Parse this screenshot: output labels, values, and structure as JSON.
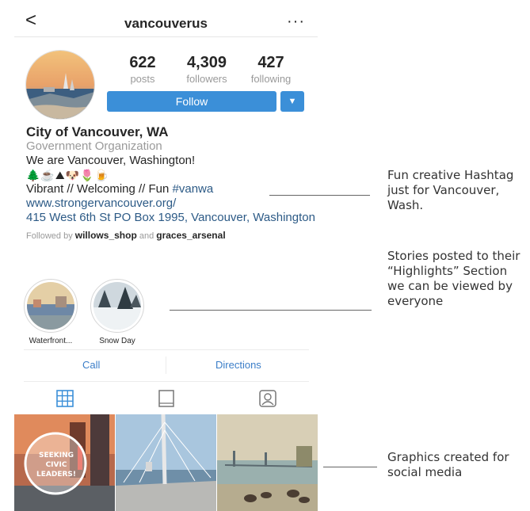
{
  "header": {
    "username": "vancouverus",
    "back_glyph": "<",
    "more_glyph": "···"
  },
  "stats": {
    "posts": {
      "value": "622",
      "label": "posts"
    },
    "followers": {
      "value": "4,309",
      "label": "followers"
    },
    "following": {
      "value": "427",
      "label": "following"
    }
  },
  "follow_button": {
    "label": "Follow",
    "dropdown_glyph": "▼"
  },
  "bio": {
    "name": "City of Vancouver, WA",
    "category": "Government Organization",
    "line1": "We are Vancouver, Washington!",
    "emoji": "🌲☕⛰🐶🌷🍺",
    "line3_text": "Vibrant // Welcoming // Fun ",
    "line3_hashtag": "#vanwa",
    "website": "www.strongervancouver.org/",
    "address": "415 West 6th St PO Box 1995, Vancouver, Washington",
    "followed_prefix": "Followed by ",
    "followed_user1": "willows_shop",
    "followed_and": " and ",
    "followed_user2": "graces_arsenal"
  },
  "highlights": [
    {
      "label": "Waterfront..."
    },
    {
      "label": "Snow Day"
    }
  ],
  "actions": {
    "call": "Call",
    "directions": "Directions"
  },
  "grid_photo_text": "SEEKING CIVIC LEADERS!",
  "annotations": {
    "hashtag": "Fun creative Hashtag just for Vancouver, Wash.",
    "highlights": "Stories posted to their “Highlights” Section we can be viewed by everyone",
    "graphics": "Graphics created for social media"
  },
  "colors": {
    "accent": "#3b8fd8",
    "link": "#2c5a86",
    "muted": "#9a9a9a"
  }
}
